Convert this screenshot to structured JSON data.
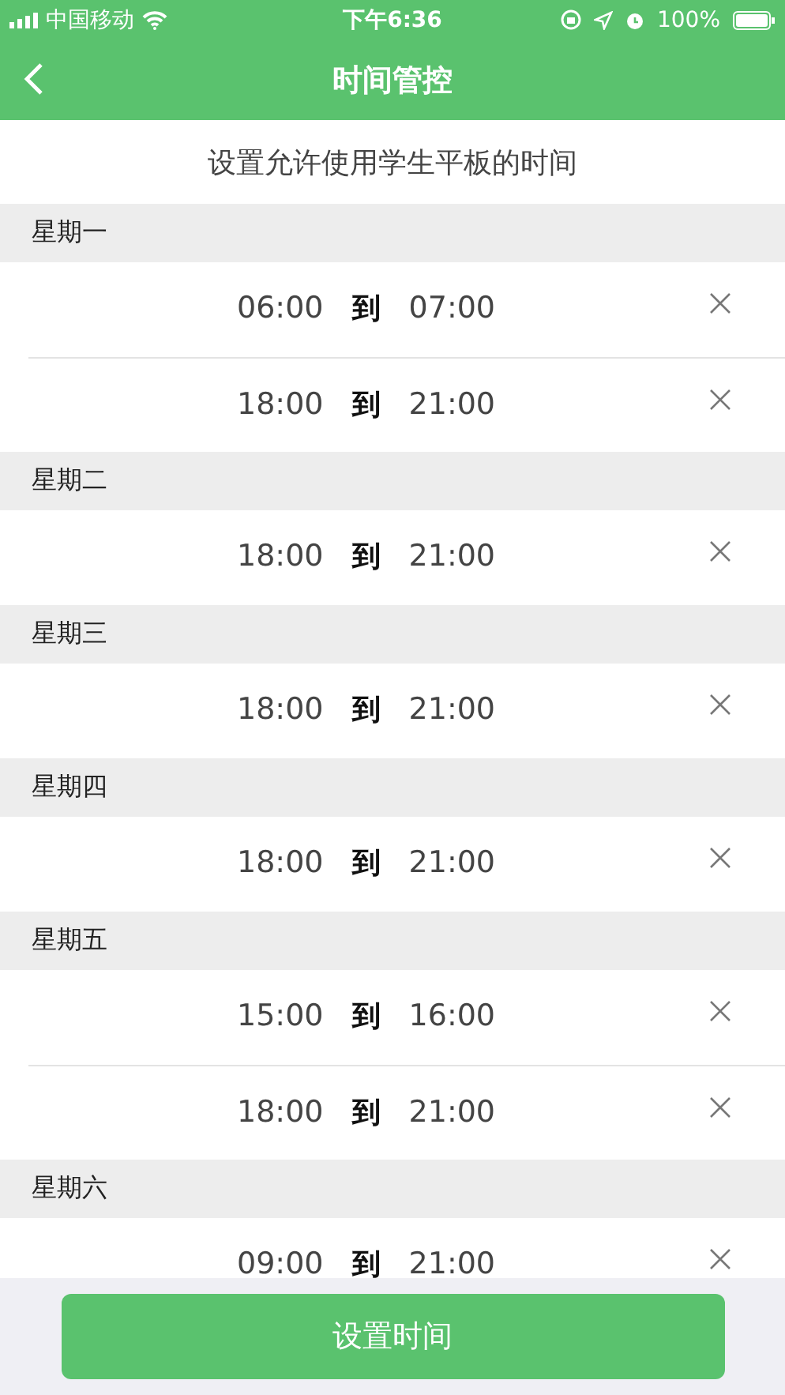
{
  "status_bar": {
    "carrier": "中国移动",
    "time": "下午6:36",
    "battery": "100%"
  },
  "nav": {
    "title": "时间管控"
  },
  "subtitle": "设置允许使用学生平板的时间",
  "days": [
    {
      "name": "星期一",
      "ranges": [
        {
          "start": "06:00",
          "sep": "到",
          "end": "07:00"
        },
        {
          "start": "18:00",
          "sep": "到",
          "end": "21:00"
        }
      ]
    },
    {
      "name": "星期二",
      "ranges": [
        {
          "start": "18:00",
          "sep": "到",
          "end": "21:00"
        }
      ]
    },
    {
      "name": "星期三",
      "ranges": [
        {
          "start": "18:00",
          "sep": "到",
          "end": "21:00"
        }
      ]
    },
    {
      "name": "星期四",
      "ranges": [
        {
          "start": "18:00",
          "sep": "到",
          "end": "21:00"
        }
      ]
    },
    {
      "name": "星期五",
      "ranges": [
        {
          "start": "15:00",
          "sep": "到",
          "end": "16:00"
        },
        {
          "start": "18:00",
          "sep": "到",
          "end": "21:00"
        }
      ]
    },
    {
      "name": "星期六",
      "ranges": [
        {
          "start": "09:00",
          "sep": "到",
          "end": "21:00"
        }
      ]
    }
  ],
  "button": "设置时间"
}
